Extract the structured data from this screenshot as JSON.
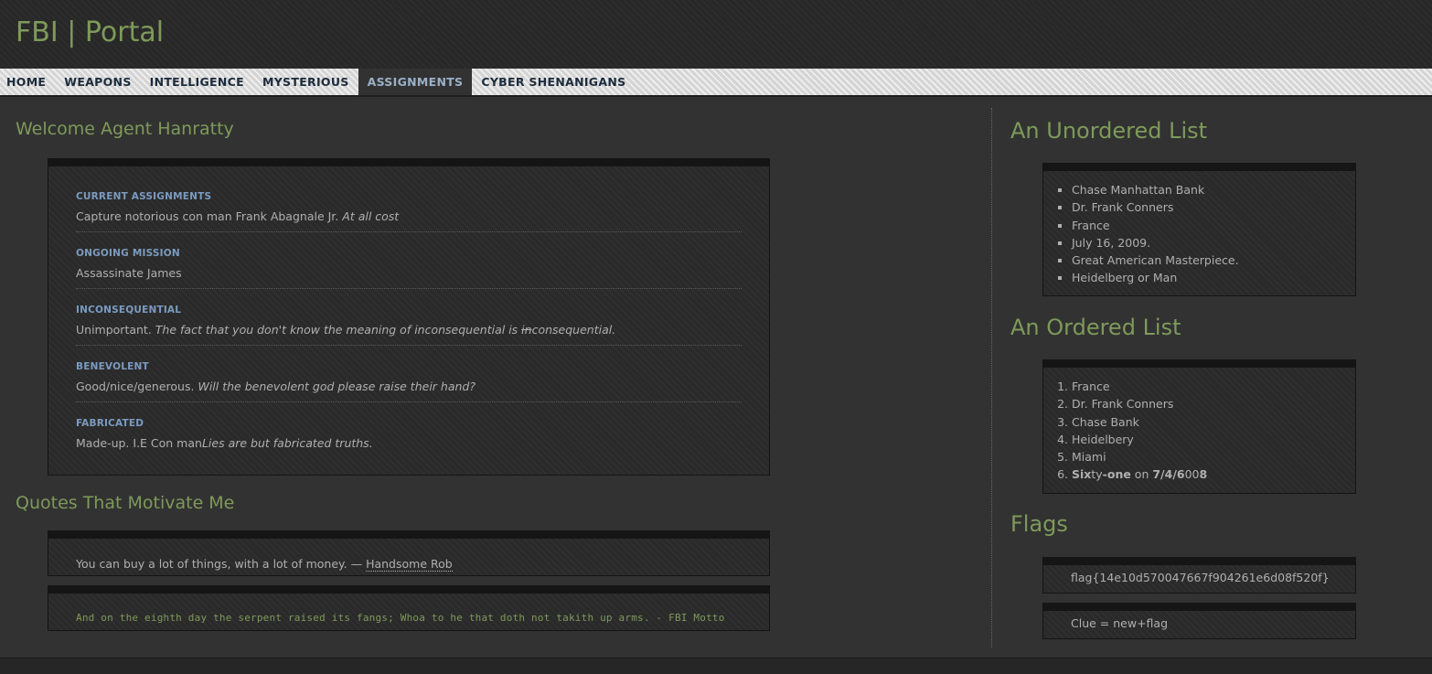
{
  "site": {
    "title": "FBI | Portal"
  },
  "nav": {
    "items": [
      {
        "label": "HOME"
      },
      {
        "label": "WEAPONS"
      },
      {
        "label": "INTELLIGENCE"
      },
      {
        "label": "MYSTERIOUS"
      },
      {
        "label": "ASSIGNMENTS",
        "active": true
      },
      {
        "label": "CYBER SHENANIGANS"
      }
    ]
  },
  "welcome": {
    "heading": "Welcome Agent Hanratty",
    "entries": [
      {
        "title": "CURRENT ASSIGNMENTS",
        "text": "Capture notorious con man Frank Abagnale Jr.",
        "emphasis": "At all cost"
      },
      {
        "title": "ONGOING MISSION",
        "text": "Assassinate James"
      },
      {
        "title": "INCONSEQUENTIAL",
        "text": "Unimportant.",
        "emphasis_part1": "The fact that you don't know the meaning of inconsequential is ",
        "emphasis_strike": "in",
        "emphasis_part2": "consequential."
      },
      {
        "title": "BENEVOLENT",
        "text": "Good/nice/generous.",
        "emphasis": "Will the benevolent god please raise their hand?"
      },
      {
        "title": "FABRICATED",
        "text": "Made-up. I.E Con man",
        "emphasis": "Lies are but fabricated truths."
      }
    ]
  },
  "quotes": {
    "heading": "Quotes That Motivate Me",
    "quote1": {
      "text": "You can buy a lot of things, with a lot of money. — ",
      "author": "Handsome Rob"
    },
    "quote2": {
      "text": "And on the eighth day the serpent raised its fangs; Whoa to he that doth not takith up arms. - FBI Motto"
    }
  },
  "unordered": {
    "heading": "An Unordered List",
    "items": [
      "Chase Manhattan Bank",
      "Dr. Frank Conners",
      "France",
      "July 16, 2009.",
      "Great American Masterpiece.",
      "Heidelberg or Man"
    ]
  },
  "ordered": {
    "heading": "An Ordered List",
    "items": [
      "France",
      "Dr. Frank Conners",
      "Chase Bank",
      "Heidelbery",
      "Miami"
    ],
    "item6": {
      "p1": "Six",
      "p2": "ty",
      "p3": "-one",
      "p4": " on ",
      "p5": "7/4/6",
      "p6": "00",
      "p7": "8"
    }
  },
  "flags": {
    "heading": "Flags",
    "flag": "flag{14e10d570047667f904261e6d08f520f}",
    "clue": "Clue = new+flag"
  },
  "colors": {
    "accent_green": "#7e9a5a",
    "label_blue": "#7b9bc0",
    "nav_text": "#1c2b3c",
    "background": "#323232"
  }
}
